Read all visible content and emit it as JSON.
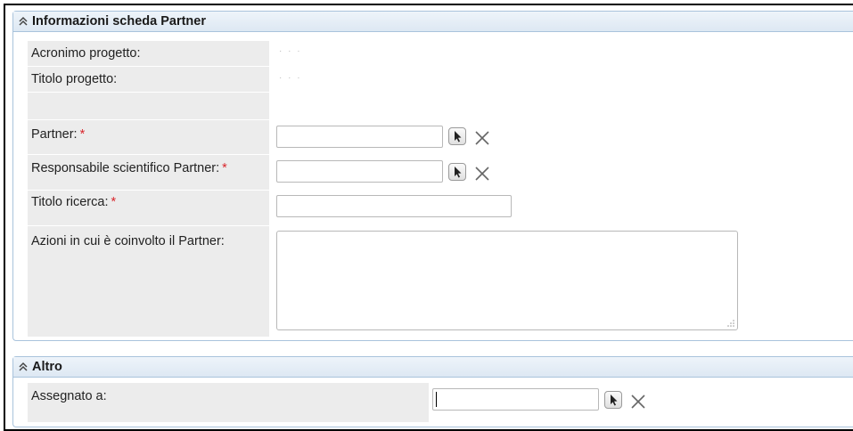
{
  "partner_section": {
    "title": "Informazioni scheda Partner",
    "fields": {
      "acronimo": {
        "label": "Acronimo progetto:",
        "value": "· · ·"
      },
      "titolo_progetto": {
        "label": "Titolo progetto:",
        "value": "·        ·              ·"
      },
      "partner": {
        "label": "Partner:",
        "required": "*",
        "value": ""
      },
      "responsabile": {
        "label": "Responsabile scientifico Partner:",
        "required": "*",
        "value": ""
      },
      "titolo_ricerca": {
        "label": "Titolo ricerca:",
        "required": "*",
        "value": ""
      },
      "azioni": {
        "label": "Azioni in cui è coinvolto il Partner:",
        "value": ""
      }
    }
  },
  "altro_section": {
    "title": "Altro",
    "fields": {
      "assegnato": {
        "label": "Assegnato a:",
        "value": ""
      }
    }
  },
  "icons": {
    "collapse": "double-chevron-up-icon",
    "pick": "cursor-pick-icon",
    "clear": "x-clear-icon"
  },
  "colors": {
    "section_border": "#a9c3dc",
    "label_bg": "#ececec",
    "required": "#d9262c"
  }
}
